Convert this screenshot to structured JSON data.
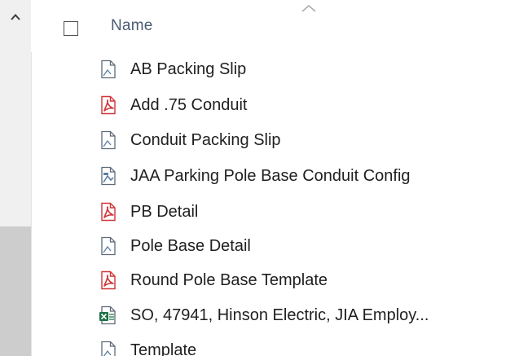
{
  "header": {
    "name_column_label": "Name"
  },
  "files": [
    {
      "name": "AB Packing Slip",
      "icon": "generic-document-icon"
    },
    {
      "name": "Add .75 Conduit",
      "icon": "pdf-document-icon"
    },
    {
      "name": "Conduit Packing Slip",
      "icon": "generic-document-icon"
    },
    {
      "name": "JAA Parking Pole Base Conduit Config",
      "icon": "config-document-icon"
    },
    {
      "name": "PB Detail",
      "icon": "pdf-document-icon"
    },
    {
      "name": "Pole Base Detail",
      "icon": "generic-document-icon"
    },
    {
      "name": "Round Pole Base Template",
      "icon": "pdf-document-icon"
    },
    {
      "name": "SO, 47941, Hinson Electric, JIA Employ...",
      "icon": "spreadsheet-document-icon"
    },
    {
      "name": "Template",
      "icon": "generic-document-icon"
    }
  ],
  "colors": {
    "pdf_accent": "#d13438",
    "doc_accent": "#5b7fa6",
    "sheet_accent": "#1e7145",
    "header_text": "#4a5a73"
  }
}
